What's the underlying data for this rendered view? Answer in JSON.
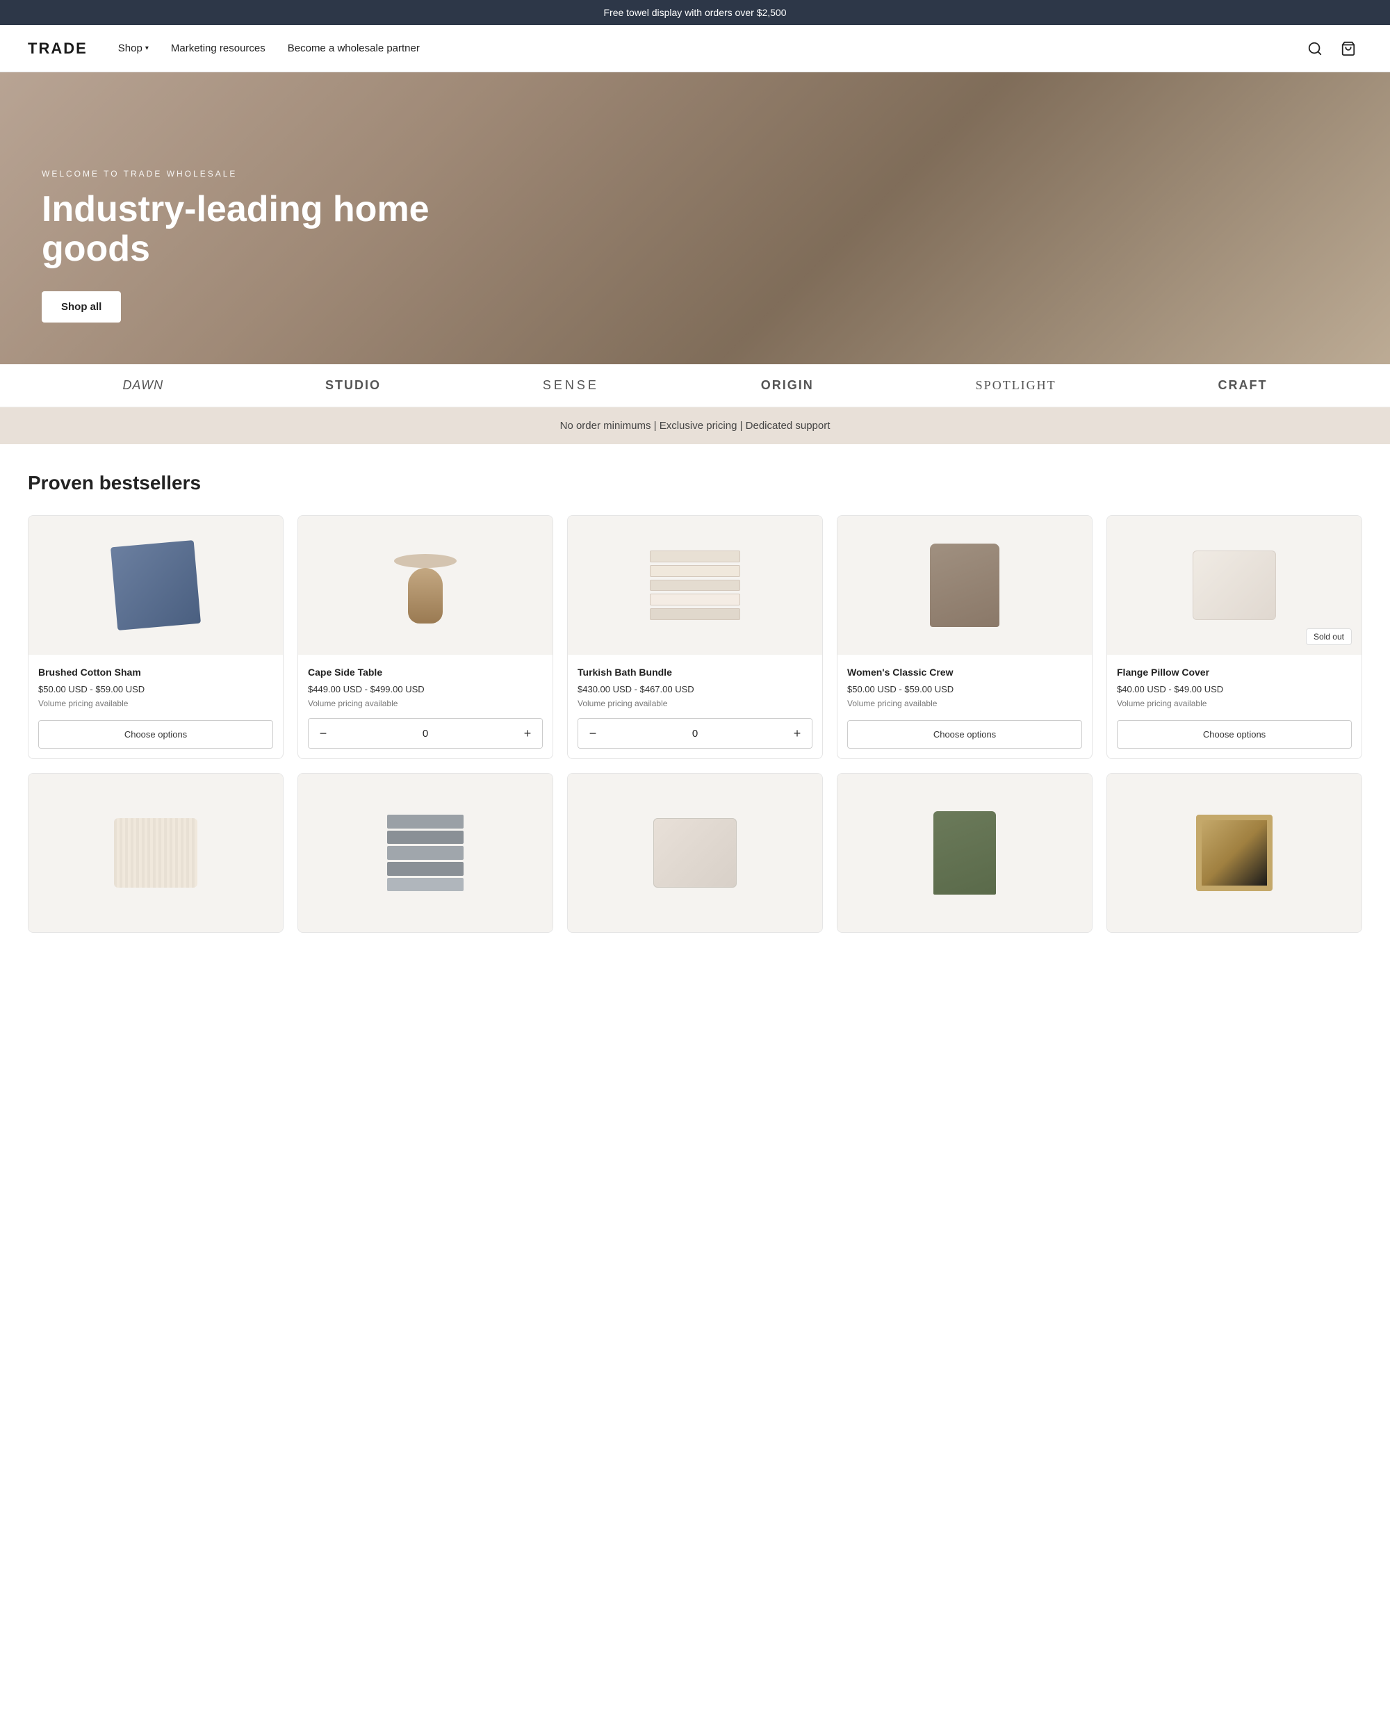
{
  "announcement": {
    "text": "Free towel display with orders over $2,500"
  },
  "header": {
    "logo": "TRADE",
    "nav": [
      {
        "label": "Shop",
        "has_dropdown": true
      },
      {
        "label": "Marketing resources",
        "has_dropdown": false
      },
      {
        "label": "Become a wholesale partner",
        "has_dropdown": false
      }
    ],
    "search_label": "Search",
    "cart_label": "Cart"
  },
  "hero": {
    "eyebrow": "WELCOME TO TRADE WHOLESALE",
    "title": "Industry-leading home goods",
    "cta": "Shop all"
  },
  "brands": [
    {
      "label": "Dawn",
      "style": "italic"
    },
    {
      "label": "STUDIO",
      "style": "normal"
    },
    {
      "label": "SENSE",
      "style": "light"
    },
    {
      "label": "ORIGIN",
      "style": "normal"
    },
    {
      "label": "spotlight",
      "style": "serif"
    },
    {
      "label": "CRAFT",
      "style": "bold"
    }
  ],
  "value_prop": {
    "text": "No order minimums | Exclusive pricing | Dedicated support"
  },
  "products_section": {
    "title": "Proven bestsellers",
    "products": [
      {
        "id": "brushed-cotton-sham",
        "name": "Brushed Cotton Sham",
        "price": "$50.00 USD - $59.00 USD",
        "volume_pricing": "Volume pricing available",
        "action": "choose",
        "sold_out": false,
        "image_type": "sham"
      },
      {
        "id": "cape-side-table",
        "name": "Cape Side Table",
        "price": "$449.00 USD - $499.00 USD",
        "volume_pricing": "Volume pricing available",
        "action": "qty",
        "qty": 0,
        "sold_out": false,
        "image_type": "table"
      },
      {
        "id": "turkish-bath-bundle",
        "name": "Turkish Bath Bundle",
        "price": "$430.00 USD - $467.00 USD",
        "volume_pricing": "Volume pricing available",
        "action": "qty",
        "qty": 0,
        "sold_out": false,
        "image_type": "towels"
      },
      {
        "id": "womens-classic-crew",
        "name": "Women's Classic Crew",
        "price": "$50.00 USD - $59.00 USD",
        "volume_pricing": "Volume pricing available",
        "action": "choose",
        "sold_out": false,
        "image_type": "crew"
      },
      {
        "id": "flange-pillow-cover",
        "name": "Flange Pillow Cover",
        "price": "$40.00 USD - $49.00 USD",
        "volume_pricing": "Volume pricing available",
        "action": "choose",
        "sold_out": true,
        "sold_out_label": "Sold out",
        "image_type": "pillow"
      }
    ],
    "row2_products": [
      {
        "id": "knit-pillow",
        "image_type": "knit-pillow"
      },
      {
        "id": "gray-towels",
        "image_type": "gray-towels"
      },
      {
        "id": "linen-sham",
        "image_type": "linen-sham"
      },
      {
        "id": "pants",
        "image_type": "pants"
      },
      {
        "id": "frame",
        "image_type": "frame"
      }
    ],
    "choose_options_label": "Choose options",
    "qty_minus_label": "−",
    "qty_plus_label": "+"
  }
}
